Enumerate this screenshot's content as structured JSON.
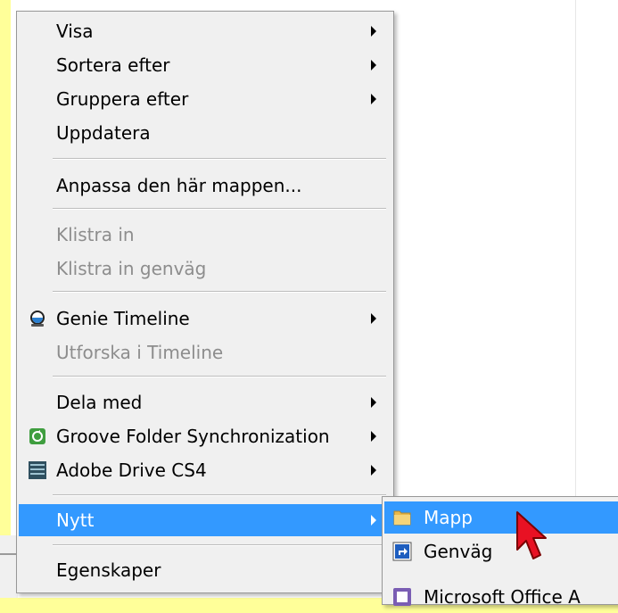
{
  "context_menu": {
    "items": [
      {
        "label": "Visa",
        "submenu": true,
        "disabled": false
      },
      {
        "label": "Sortera efter",
        "submenu": true,
        "disabled": false
      },
      {
        "label": "Gruppera efter",
        "submenu": true,
        "disabled": false
      },
      {
        "label": "Uppdatera",
        "submenu": false,
        "disabled": false
      },
      {
        "label": "Anpassa den här mappen...",
        "submenu": false,
        "disabled": false
      },
      {
        "label": "Klistra in",
        "submenu": false,
        "disabled": true
      },
      {
        "label": "Klistra in genväg",
        "submenu": false,
        "disabled": true
      },
      {
        "label": "Genie Timeline",
        "submenu": true,
        "disabled": false,
        "icon": "genie-timeline-icon"
      },
      {
        "label": "Utforska i Timeline",
        "submenu": false,
        "disabled": true
      },
      {
        "label": "Dela med",
        "submenu": true,
        "disabled": false
      },
      {
        "label": "Groove Folder Synchronization",
        "submenu": true,
        "disabled": false,
        "icon": "groove-icon"
      },
      {
        "label": "Adobe Drive CS4",
        "submenu": true,
        "disabled": false,
        "icon": "adobe-drive-icon"
      },
      {
        "label": "Nytt",
        "submenu": true,
        "disabled": false,
        "highlighted": true
      },
      {
        "label": "Egenskaper",
        "submenu": false,
        "disabled": false
      }
    ]
  },
  "new_submenu": {
    "items": [
      {
        "label": "Mapp",
        "icon": "folder-icon",
        "highlighted": true
      },
      {
        "label": "Genväg",
        "icon": "shortcut-icon"
      },
      {
        "label": "Microsoft Office A",
        "icon": "office-icon"
      }
    ]
  },
  "colors": {
    "highlight": "#3399ff",
    "menu_bg": "#f0f0f0",
    "disabled_text": "#8d8d8d",
    "desktop_bg": "#ffff99",
    "cursor": "#e81123"
  }
}
